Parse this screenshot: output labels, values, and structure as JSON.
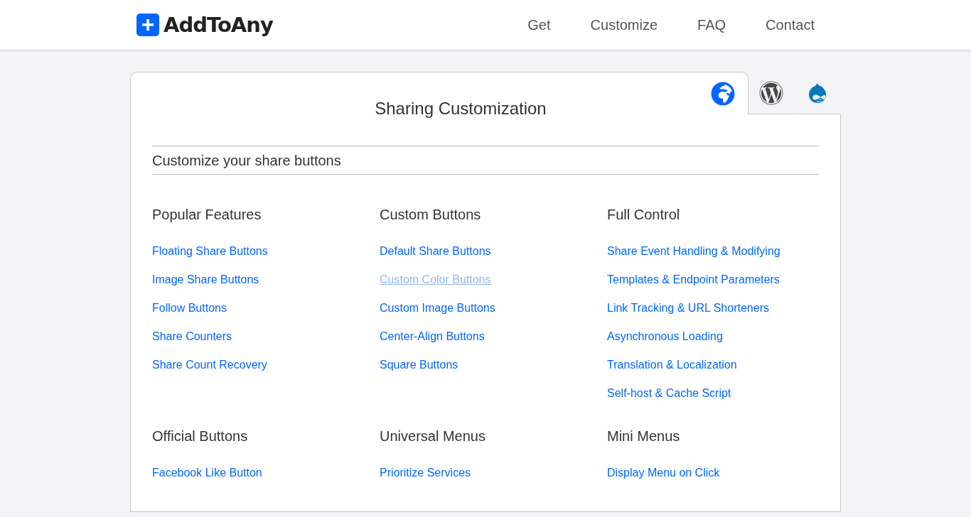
{
  "header": {
    "logo": {
      "mark": "+",
      "name": "AddToAny"
    },
    "nav": [
      "Get",
      "Customize",
      "FAQ",
      "Contact"
    ]
  },
  "platform_tabs": [
    {
      "kind": "web",
      "selected": true
    },
    {
      "kind": "wordpress",
      "selected": false
    },
    {
      "kind": "drupal",
      "selected": false
    }
  ],
  "title": "Sharing Customization",
  "subtitle": "Customize your share buttons",
  "sections": [
    {
      "heading": "Popular Features",
      "links": [
        {
          "label": "Floating Share Buttons",
          "muted": false
        },
        {
          "label": "Image Share Buttons",
          "muted": false
        },
        {
          "label": "Follow Buttons",
          "muted": false
        },
        {
          "label": "Share Counters",
          "muted": false
        },
        {
          "label": "Share Count Recovery",
          "muted": false
        }
      ]
    },
    {
      "heading": "Custom Buttons",
      "links": [
        {
          "label": "Default Share Buttons",
          "muted": false
        },
        {
          "label": "Custom Color Buttons",
          "muted": true
        },
        {
          "label": "Custom Image Buttons",
          "muted": false
        },
        {
          "label": "Center-Align Buttons",
          "muted": false
        },
        {
          "label": "Square Buttons",
          "muted": false
        }
      ]
    },
    {
      "heading": "Full Control",
      "links": [
        {
          "label": "Share Event Handling & Modifying",
          "muted": false
        },
        {
          "label": "Templates & Endpoint Parameters",
          "muted": false
        },
        {
          "label": "Link Tracking & URL Shorteners",
          "muted": false
        },
        {
          "label": "Asynchronous Loading",
          "muted": false
        },
        {
          "label": "Translation & Localization",
          "muted": false
        },
        {
          "label": "Self-host & Cache Script",
          "muted": false
        }
      ]
    },
    {
      "heading": "Official Buttons",
      "links": [
        {
          "label": "Facebook Like Button",
          "muted": false
        }
      ]
    },
    {
      "heading": "Universal Menus",
      "links": [
        {
          "label": "Prioritize Services",
          "muted": false
        }
      ]
    },
    {
      "heading": "Mini Menus",
      "links": [
        {
          "label": "Display Menu on Click",
          "muted": false
        }
      ]
    }
  ]
}
